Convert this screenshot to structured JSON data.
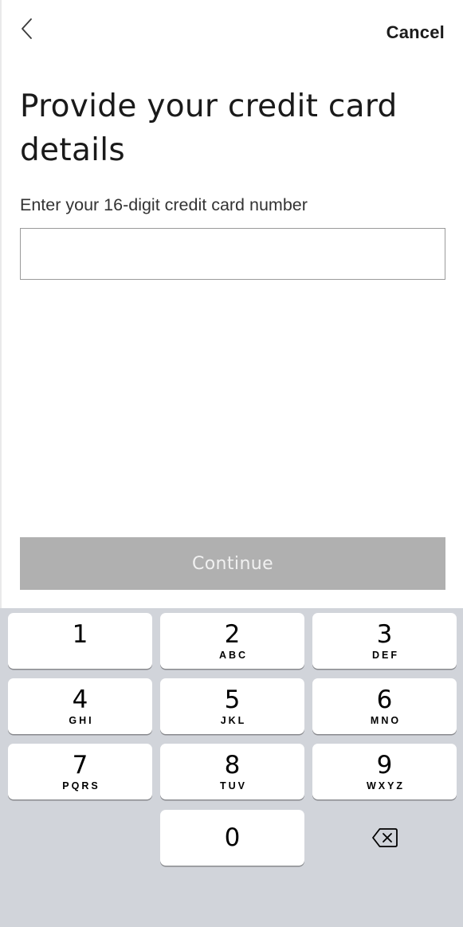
{
  "nav": {
    "back_icon": "chevron-left-icon",
    "cancel_label": "Cancel"
  },
  "page": {
    "title": "Provide your credit card details",
    "field_label": "Enter your 16-digit credit card number",
    "card_number_value": "",
    "continue_label": "Continue"
  },
  "keypad": {
    "keys": [
      {
        "digit": "1",
        "letters": ""
      },
      {
        "digit": "2",
        "letters": "ABC"
      },
      {
        "digit": "3",
        "letters": "DEF"
      },
      {
        "digit": "4",
        "letters": "GHI"
      },
      {
        "digit": "5",
        "letters": "JKL"
      },
      {
        "digit": "6",
        "letters": "MNO"
      },
      {
        "digit": "7",
        "letters": "PQRS"
      },
      {
        "digit": "8",
        "letters": "TUV"
      },
      {
        "digit": "9",
        "letters": "WXYZ"
      },
      {
        "digit": "0",
        "letters": ""
      }
    ],
    "delete_icon": "backspace-icon"
  },
  "colors": {
    "keypad_background": "#d1d4da",
    "continue_disabled": "#b0b0b0",
    "key_background": "#ffffff"
  }
}
